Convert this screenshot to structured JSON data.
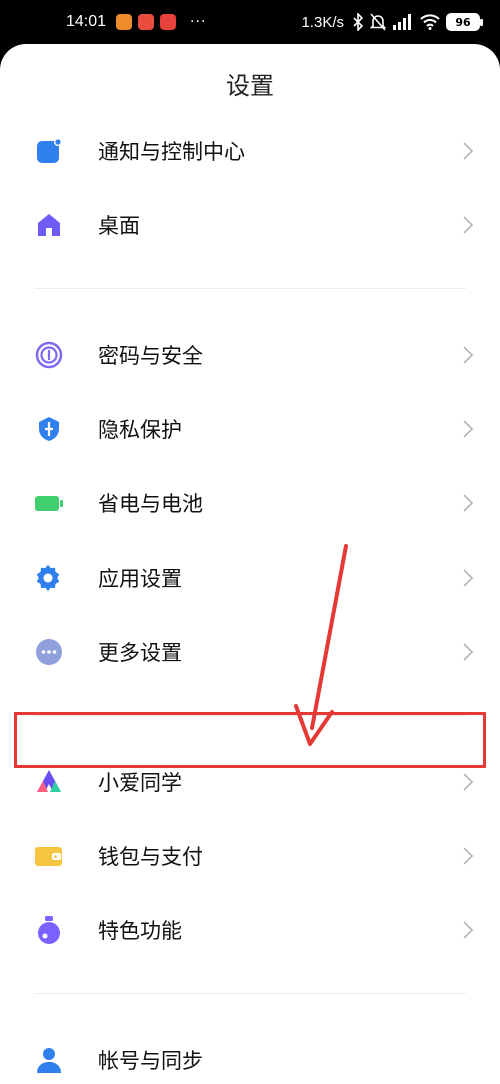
{
  "status_bar": {
    "time": "14:01",
    "dots": "···",
    "net_speed": "1.3K/s",
    "battery": "96",
    "notif_colors": [
      "#f08c2b",
      "#e84d3d",
      "#e8403b"
    ]
  },
  "page": {
    "title": "设置"
  },
  "items": [
    {
      "label": "通知与控制中心",
      "icon": "notification-icon",
      "color": "#2f80ed"
    },
    {
      "label": "桌面",
      "icon": "home-icon",
      "color": "#6e5cf6"
    },
    {
      "label": "密码与安全",
      "icon": "fingerprint-icon",
      "color": "#7e6cf0"
    },
    {
      "label": "隐私保护",
      "icon": "privacy-icon",
      "color": "#2f80ed"
    },
    {
      "label": "省电与电池",
      "icon": "battery-icon",
      "color": "#3fcf6e"
    },
    {
      "label": "应用设置",
      "icon": "gear-icon",
      "color": "#2f80ed"
    },
    {
      "label": "更多设置",
      "icon": "more-icon",
      "color": "#8fa0dc"
    },
    {
      "label": "小爱同学",
      "icon": "xiaoai-icon",
      "color": "#6a4cf3"
    },
    {
      "label": "钱包与支付",
      "icon": "wallet-icon",
      "color": "#f5c542"
    },
    {
      "label": "特色功能",
      "icon": "feature-icon",
      "color": "#7b61ff"
    },
    {
      "label": "帐号与同步",
      "icon": "account-icon",
      "color": "#2f80ed"
    }
  ],
  "annotation": {
    "highlight_color": "#e53935"
  }
}
